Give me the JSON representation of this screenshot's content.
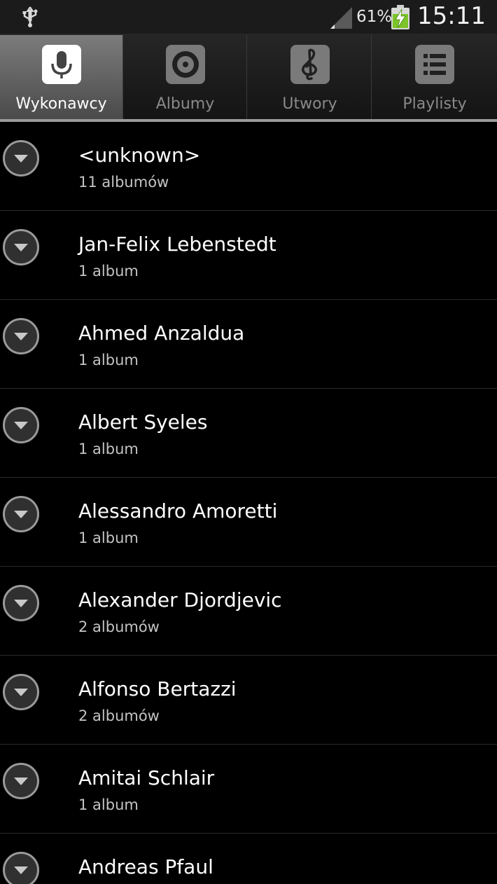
{
  "status_bar": {
    "battery_percent": "61%",
    "time": "15:11",
    "icons": [
      "usb-icon",
      "signal-icon",
      "battery-charging-icon"
    ]
  },
  "tabs": [
    {
      "label": "Wykonawcy",
      "icon": "microphone-icon",
      "active": true
    },
    {
      "label": "Albumy",
      "icon": "disc-icon",
      "active": false
    },
    {
      "label": "Utwory",
      "icon": "treble-clef-icon",
      "active": false
    },
    {
      "label": "Playlisty",
      "icon": "playlist-icon",
      "active": false
    }
  ],
  "artists": [
    {
      "name": "<unknown>",
      "albums": "11 albumów"
    },
    {
      "name": "Jan-Felix Lebenstedt",
      "albums": "1 album"
    },
    {
      "name": "Ahmed Anzaldua",
      "albums": "1 album"
    },
    {
      "name": "Albert Syeles",
      "albums": "1 album"
    },
    {
      "name": "Alessandro Amoretti",
      "albums": "1 album"
    },
    {
      "name": "Alexander Djordjevic",
      "albums": "2 albumów"
    },
    {
      "name": "Alfonso Bertazzi",
      "albums": "2 albumów"
    },
    {
      "name": "Amitai Schlair",
      "albums": "1 album"
    },
    {
      "name": "Andreas Pfaul",
      "albums": ""
    }
  ],
  "colors": {
    "background": "#000000",
    "status_bar": "#1b1b1b",
    "tab_active": "#7c7c7c",
    "battery_green": "#7cc42a"
  }
}
